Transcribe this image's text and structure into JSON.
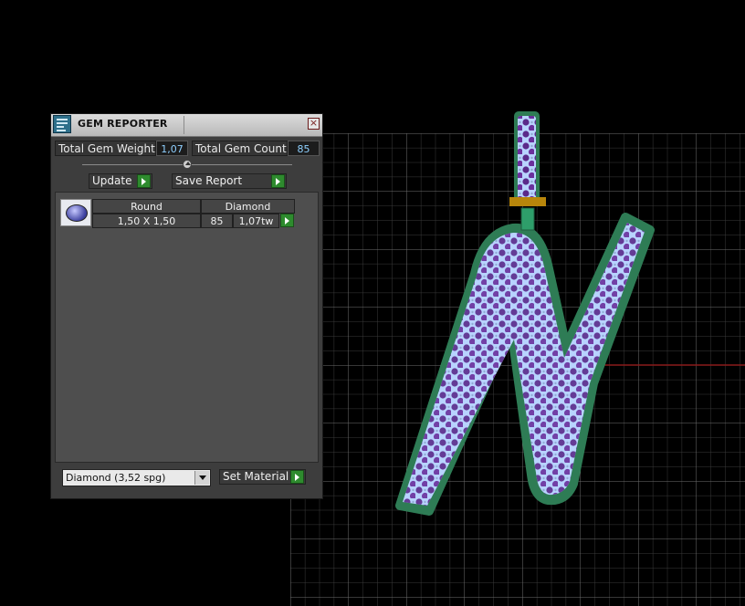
{
  "window": {
    "title": "GEM REPORTER",
    "close_icon": "close-icon",
    "app_icon": "gem-report-icon"
  },
  "summary": {
    "weight_label": "Total Gem Weight",
    "weight_value": "1,07",
    "count_label": "Total Gem Count",
    "count_value": "85"
  },
  "toolbar": {
    "update_label": "Update",
    "save_label": "Save Report"
  },
  "gems": [
    {
      "shape": "Round",
      "material": "Diamond",
      "size": "1,50 X 1,50",
      "count": "85",
      "weight": "1,07tw"
    }
  ],
  "footer": {
    "material_select": "Diamond     (3,52 spg)",
    "set_material_label": "Set Material"
  },
  "colors": {
    "panel_bg": "#3d3d3d",
    "value_text": "#8fd0ff",
    "accent_green": "#2e8b2e",
    "viewport_grid": "#5a5a5a",
    "letter_fill": "#b8d3ff",
    "letter_outline": "#2e7c55",
    "gem_dots": "#5b2a8a",
    "axis_red": "#8b1a1a"
  }
}
